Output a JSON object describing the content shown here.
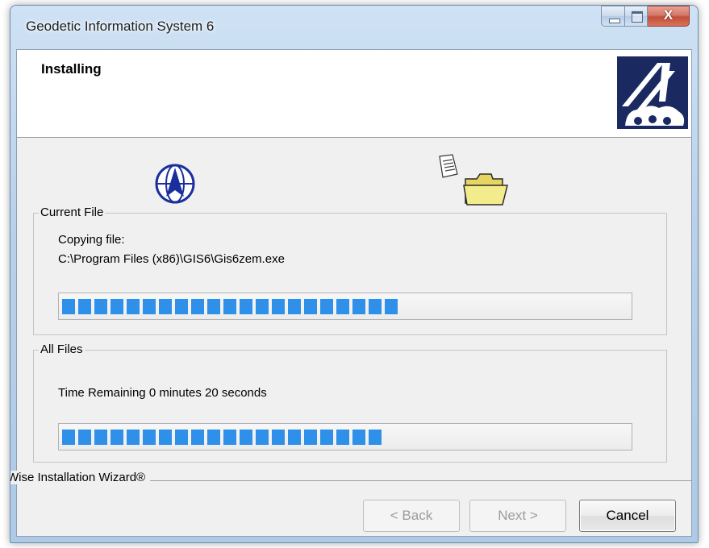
{
  "window": {
    "title": "Geodetic Information System 6",
    "close_glyph": "X"
  },
  "header": {
    "title": "Installing"
  },
  "current_file": {
    "legend": "Current File",
    "line1": "Copying file:",
    "line2": "C:\\Program Files (x86)\\GIS6\\Gis6zem.exe",
    "progress": 0.61
  },
  "all_files": {
    "legend": "All Files",
    "time_remaining": "Time Remaining 0 minutes 20 seconds",
    "progress": 0.58
  },
  "footer": {
    "brand": "Wise Installation Wizard®"
  },
  "buttons": {
    "back": "< Back",
    "next": "Next >",
    "cancel": "Cancel"
  },
  "icons": {
    "logo": "gis-logo-icon",
    "globe": "globe-icon",
    "document": "document-icon",
    "folder": "folder-icon"
  },
  "colors": {
    "progress": "#2e90e8",
    "logo_bg": "#1a2960"
  }
}
